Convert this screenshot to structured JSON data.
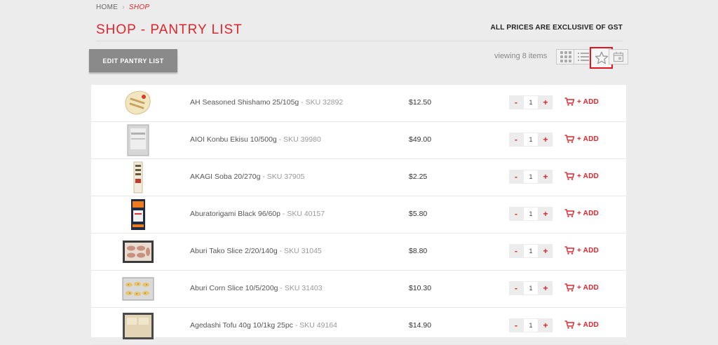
{
  "breadcrumb": {
    "home": "HOME",
    "separator": "›",
    "current": "SHOP"
  },
  "page": {
    "title": "SHOP - PANTRY LIST",
    "gst_notice": "ALL PRICES ARE EXCLUSIVE OF GST",
    "edit_button": "EDIT PANTRY LIST",
    "viewing": "viewing 8 items"
  },
  "view_modes": [
    {
      "name": "grid-view",
      "icon": "grid-icon"
    },
    {
      "name": "list-view",
      "icon": "list-icon"
    },
    {
      "name": "favourites-view",
      "icon": "star-icon",
      "highlighted": true
    },
    {
      "name": "calendar-view",
      "icon": "calendar-icon"
    }
  ],
  "colors": {
    "accent": "#e0252b",
    "highlight": "#e3141b",
    "button": "#8a8a8a"
  },
  "items": [
    {
      "name": "AH Seasoned Shishamo 25/105g",
      "sku": "- SKU 32892",
      "price": "$12.50",
      "qty": "1",
      "add": "+ ADD",
      "minus": "-",
      "plus": "+"
    },
    {
      "name": "AIOI Konbu Ekisu 10/500g",
      "sku": "- SKU 39980",
      "price": "$49.00",
      "qty": "1",
      "add": "+ ADD",
      "minus": "-",
      "plus": "+"
    },
    {
      "name": "AKAGI Soba 20/270g",
      "sku": "- SKU 37905",
      "price": "$2.25",
      "qty": "1",
      "add": "+ ADD",
      "minus": "-",
      "plus": "+"
    },
    {
      "name": "Aburatorigami Black 96/60p",
      "sku": "- SKU 40157",
      "price": "$5.80",
      "qty": "1",
      "add": "+ ADD",
      "minus": "-",
      "plus": "+"
    },
    {
      "name": "Aburi Tako Slice 2/20/140g",
      "sku": "- SKU 31045",
      "price": "$8.80",
      "qty": "1",
      "add": "+ ADD",
      "minus": "-",
      "plus": "+"
    },
    {
      "name": "Aburi Corn Slice 10/5/200g",
      "sku": "- SKU 31403",
      "price": "$10.30",
      "qty": "1",
      "add": "+ ADD",
      "minus": "-",
      "plus": "+"
    },
    {
      "name": "Agedashi Tofu 40g 10/1kg 25pc",
      "sku": "- SKU 49164",
      "price": "$14.90",
      "qty": "1",
      "add": "+ ADD",
      "minus": "-",
      "plus": "+"
    }
  ]
}
